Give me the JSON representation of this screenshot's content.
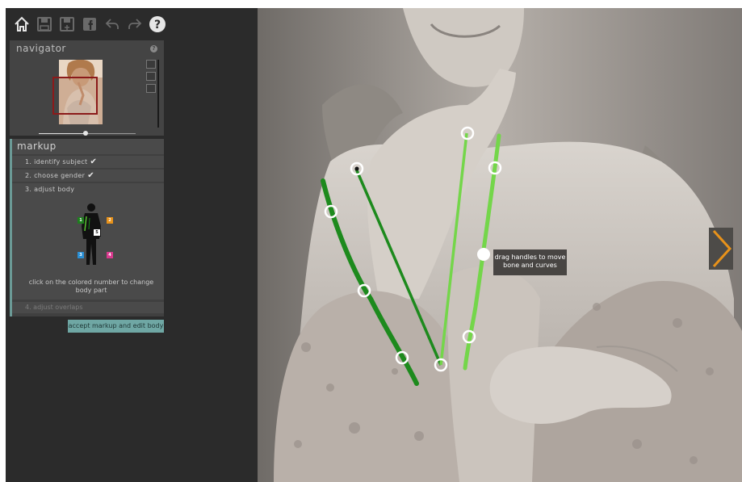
{
  "toolbar": {
    "icons": [
      "home-icon",
      "save-icon",
      "save-as-icon",
      "facebook-icon",
      "undo-icon",
      "redo-icon",
      "help-icon"
    ]
  },
  "navigator": {
    "title": "navigator",
    "help": "?",
    "zoom_level_fraction": 0.48,
    "view_icons": [
      "fit-height-icon",
      "fit-body-icon",
      "fit-width-icon"
    ]
  },
  "markup": {
    "title": "markup",
    "steps": [
      {
        "label": "1. identify subject",
        "done": true
      },
      {
        "label": "2. choose gender",
        "done": true
      },
      {
        "label": "3. adjust body",
        "done": false
      },
      {
        "label": "4. adjust overlaps",
        "done": false
      }
    ],
    "check": "✔",
    "body_parts": [
      {
        "num": "1",
        "color": "#1e7f1e"
      },
      {
        "num": "2",
        "color": "#e8921a"
      },
      {
        "num": "3",
        "color": "#2a8fd4"
      },
      {
        "num": "4",
        "color": "#d9398e"
      },
      {
        "num": "5",
        "color": "#ffffff"
      }
    ],
    "hint": "click on the colored number to change body part"
  },
  "accept_button": "accept markup and edit body",
  "canvas": {
    "tooltip": "drag handles to move bone and curves",
    "colors": {
      "dark_green": "#1d8a1d",
      "light_green": "#74d64a",
      "mid_green": "#59c431",
      "handle": "#ffffff"
    },
    "next_icon": "chevron-right-icon",
    "next_color": "#e8921a"
  }
}
